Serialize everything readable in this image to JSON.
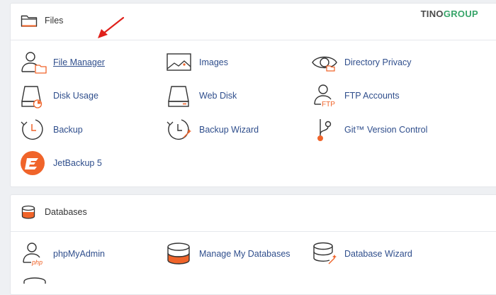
{
  "brand": {
    "part1": "TINO",
    "part2": "GROUP"
  },
  "files": {
    "title": "Files",
    "icon": "folder-icon",
    "tools": [
      {
        "label": "File Manager",
        "icon": "file-manager-icon"
      },
      {
        "label": "Images",
        "icon": "images-icon"
      },
      {
        "label": "Directory Privacy",
        "icon": "directory-privacy-icon"
      },
      {
        "label": "Disk Usage",
        "icon": "disk-usage-icon"
      },
      {
        "label": "Web Disk",
        "icon": "web-disk-icon"
      },
      {
        "label": "FTP Accounts",
        "icon": "ftp-accounts-icon"
      },
      {
        "label": "Backup",
        "icon": "backup-icon"
      },
      {
        "label": "Backup Wizard",
        "icon": "backup-wizard-icon"
      },
      {
        "label": "Git™ Version Control",
        "icon": "git-icon"
      },
      {
        "label": "JetBackup 5",
        "icon": "jetbackup-icon"
      }
    ]
  },
  "databases": {
    "title": "Databases",
    "icon": "database-icon",
    "tools": [
      {
        "label": "phpMyAdmin",
        "icon": "phpmyadmin-icon"
      },
      {
        "label": "Manage My Databases",
        "icon": "manage-databases-icon"
      },
      {
        "label": "Database Wizard",
        "icon": "database-wizard-icon"
      }
    ]
  },
  "colors": {
    "link": "#2f4e8c",
    "accent_orange": "#f0642a",
    "arrow_red": "#e0211b",
    "brand_green": "#38a56a"
  }
}
